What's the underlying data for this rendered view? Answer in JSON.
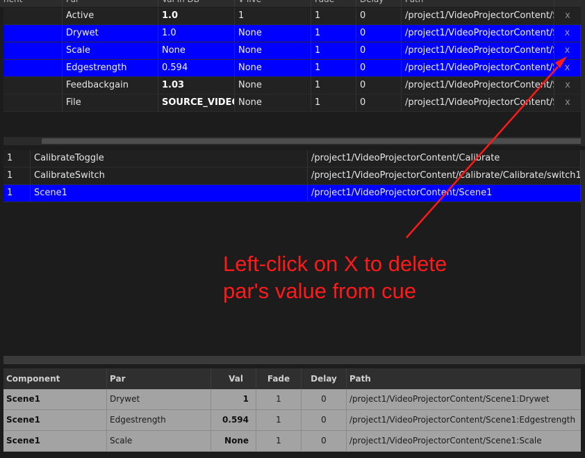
{
  "param_table": {
    "headers": [
      "nent",
      "Par",
      "Val in DB",
      "V live",
      "Fade",
      "Delay",
      "Path",
      ""
    ],
    "rows": [
      {
        "par": "Active",
        "val": "1.0",
        "val_bold": true,
        "live": "1",
        "fade": "1",
        "delay": "0",
        "path": "/project1/VideoProjectorContent/S",
        "delete": "x",
        "selected": false
      },
      {
        "par": "Drywet",
        "val": "1.0",
        "val_bold": false,
        "live": "None",
        "fade": "1",
        "delay": "0",
        "path": "/project1/VideoProjectorContent/S",
        "delete": "x",
        "selected": true
      },
      {
        "par": "Scale",
        "val": "None",
        "val_bold": false,
        "live": "None",
        "fade": "1",
        "delay": "0",
        "path": "/project1/VideoProjectorContent/S",
        "delete": "x",
        "selected": true
      },
      {
        "par": "Edgestrength",
        "val": "0.594",
        "val_bold": false,
        "live": "None",
        "fade": "1",
        "delay": "0",
        "path": "/project1/VideoProjectorContent/S",
        "delete": "x",
        "selected": true
      },
      {
        "par": "Feedbackgain",
        "val": "1.03",
        "val_bold": true,
        "live": "None",
        "fade": "1",
        "delay": "0",
        "path": "/project1/VideoProjectorContent/S",
        "delete": "x",
        "selected": false
      },
      {
        "par": "File",
        "val": "SOURCE_VIDEO",
        "val_bold": true,
        "live": "None",
        "fade": "1",
        "delay": "0",
        "path": "/project1/VideoProjectorContent/S",
        "delete": "x",
        "selected": false
      }
    ]
  },
  "ops_list": {
    "rows": [
      {
        "idx": "1",
        "name": "CalibrateToggle",
        "path": "/project1/VideoProjectorContent/Calibrate",
        "selected": false
      },
      {
        "idx": "1",
        "name": "CalibrateSwitch",
        "path": "/project1/VideoProjectorContent/Calibrate/Calibrate/switch1",
        "selected": false
      },
      {
        "idx": "1",
        "name": "Scene1",
        "path": "/project1/VideoProjectorContent/Scene1",
        "selected": true
      }
    ]
  },
  "cue_table": {
    "headers": {
      "component": "Component",
      "par": "Par",
      "val": "Val",
      "fade": "Fade",
      "delay": "Delay",
      "path": "Path"
    },
    "rows": [
      {
        "component": "Scene1",
        "par": "Drywet",
        "val": "1",
        "fade": "1",
        "delay": "0",
        "path": "/project1/VideoProjectorContent/Scene1:Drywet"
      },
      {
        "component": "Scene1",
        "par": "Edgestrength",
        "val": "0.594",
        "fade": "1",
        "delay": "0",
        "path": "/project1/VideoProjectorContent/Scene1:Edgestrength"
      },
      {
        "component": "Scene1",
        "par": "Scale",
        "val": "None",
        "fade": "1",
        "delay": "0",
        "path": "/project1/VideoProjectorContent/Scene1:Scale"
      }
    ]
  },
  "annotation": {
    "line1": "Left-click on X to delete",
    "line2": "par's value from cue",
    "color": "#ff1a1a"
  },
  "colors": {
    "selection": "#0000ff",
    "panel_bg": "#1c1c1c",
    "cue_row_bg": "#a3a3a3"
  }
}
